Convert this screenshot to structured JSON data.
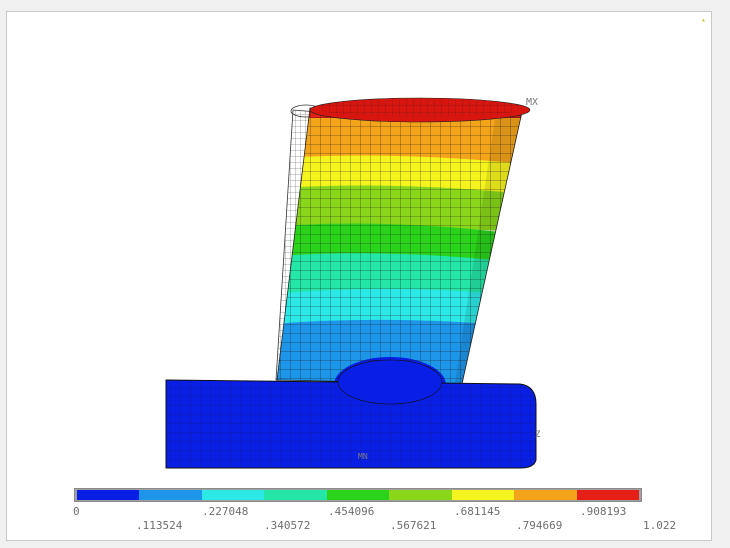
{
  "viewport": {
    "max_label": "MX",
    "min_label": "MN",
    "axis_label": "Z"
  },
  "legend": {
    "colors": [
      "#0a1fe6",
      "#1d95e8",
      "#2ce8e6",
      "#24e6a6",
      "#2ad21a",
      "#8ad61a",
      "#f6f41e",
      "#f3a41a",
      "#e61e18"
    ],
    "values_top": [
      "0",
      ".227048",
      ".454096",
      ".681145",
      ".908193"
    ],
    "values_bottom": [
      ".113524",
      ".340572",
      ".567621",
      ".794669",
      "1.022"
    ]
  }
}
